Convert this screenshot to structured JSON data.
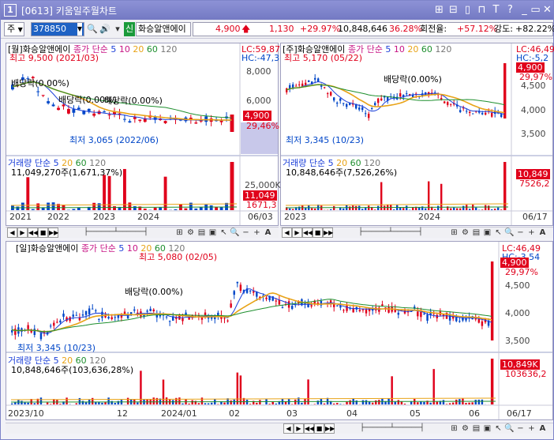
{
  "window": {
    "badge": "1",
    "title": "[0613] 키움일주월차트",
    "controls": [
      "⊞",
      "⊟",
      "▯",
      "⊓",
      "T",
      "?",
      "_",
      "▭",
      "✕"
    ]
  },
  "toolbar": {
    "market_select": "주",
    "code": "378850",
    "market_code_badge": "신",
    "stock_name": "화승알앤에이",
    "price": "4,900",
    "change": "1,130",
    "change_pct": "+29.97%",
    "volume": "10,848,646",
    "volume_pct": "36.28%",
    "turnover_label": "회전율:",
    "turnover": "+57.12%",
    "strength_label": "강도:",
    "strength": "+82.22%"
  },
  "monthly": {
    "header": "[월]화승알앤에이",
    "ma_label": "종가 단순",
    "ma_periods": [
      "5",
      "10",
      "20",
      "60",
      "120"
    ],
    "high_label": "최고 9,500 (2021/03)",
    "low_label": "최저 3,065 (2022/06)",
    "dividend1": "배당락(0.00%)",
    "dividend2": "배당락(0.00%)",
    "dividend3": "배당락(0.00%)",
    "lc": "LC:59,87",
    "hc": "HC:-47,3",
    "axis": [
      "8,000",
      "6,000"
    ],
    "price_tag": "4,900",
    "price_tag2": "29,46%",
    "vol_header": "거래량 단순",
    "vol_periods": [
      "5",
      "20",
      "60",
      "120"
    ],
    "vol_value": "11,049,270주(1,671,37%)",
    "vol_axis": "25,000K",
    "vol_tag": "11,049",
    "vol_tag2": "1671,3",
    "x_labels": [
      "2021",
      "2022",
      "2023",
      "2024"
    ],
    "date_right": "06/03"
  },
  "weekly": {
    "header": "[주]화승알앤에이",
    "ma_label": "종가 단순",
    "ma_periods": [
      "5",
      "10",
      "20",
      "60",
      "120"
    ],
    "high_label": "최고 5,170 (05/22)",
    "low_label": "최저 3,345 (10/23)",
    "dividend": "배당락(0.00%)",
    "lc": "LC:46,49",
    "hc": "HC:-5,2",
    "axis": [
      "4,500",
      "4,000",
      "3,500"
    ],
    "price_tag": "4,900",
    "price_tag2": "29,97%",
    "vol_header": "거래량 단순",
    "vol_periods": [
      "5",
      "20",
      "60",
      "120"
    ],
    "vol_value": "10,848,646주(7,526,26%)",
    "vol_tag": "10,849",
    "vol_tag2": "7526,2",
    "x_labels": [
      "2023",
      "2024"
    ],
    "date_right": "06/17"
  },
  "daily": {
    "header": "[일]화승알앤에이",
    "ma_label": "종가 단순",
    "ma_periods": [
      "5",
      "10",
      "20",
      "60",
      "120"
    ],
    "high_label": "최고 5,080 (02/05)",
    "low_label": "최저 3,345 (10/23)",
    "dividend": "배당락(0.00%)",
    "lc": "LC:46,49",
    "hc": "HC:-3,54",
    "axis": [
      "4,500",
      "4,000",
      "3,500"
    ],
    "price_tag": "4,900",
    "price_tag2": "29,97%",
    "vol_header": "거래량 단순",
    "vol_periods": [
      "5",
      "20",
      "60",
      "120"
    ],
    "vol_value": "10,848,646주(103,636,28%)",
    "vol_tag": "10,849K",
    "vol_tag2": "103636,2",
    "x_labels": [
      "2023/10",
      "12",
      "2024/01",
      "02",
      "03",
      "04",
      "05",
      "06"
    ],
    "date_right": "06/17"
  },
  "colors": {
    "up": "#e0001b",
    "down": "#0046c8",
    "ma5": "#1b3fd9",
    "ma10": "#c71585",
    "ma20": "#e8a317",
    "ma60": "#1e8f2e",
    "ma120": "#777777"
  }
}
